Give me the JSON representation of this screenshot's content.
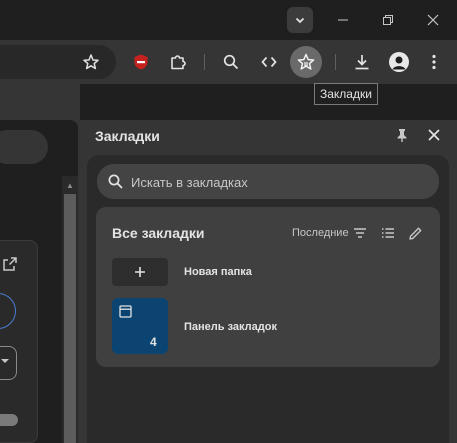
{
  "tooltip": {
    "text": "Закладки"
  },
  "side_panel": {
    "title": "Закладки",
    "search": {
      "placeholder": "Искать в закладках"
    },
    "folder_section": {
      "title": "Все закладки",
      "sort_label": "Последние",
      "items": [
        {
          "label": "Новая папка",
          "icon": "plus-icon"
        },
        {
          "label": "Панель закладок",
          "count": "4",
          "icon": "bookmarks-bar-icon"
        }
      ]
    }
  },
  "toolbar": {
    "icons": [
      "bookmark-star-icon",
      "shield-extension-icon",
      "extensions-puzzle-icon",
      "search-icon",
      "code-icon",
      "bookmarks-panel-icon",
      "download-icon",
      "profile-avatar-icon",
      "more-menu-icon"
    ]
  },
  "colors": {
    "accent_tile": "#0b4470",
    "shield_red": "#c5221f"
  }
}
